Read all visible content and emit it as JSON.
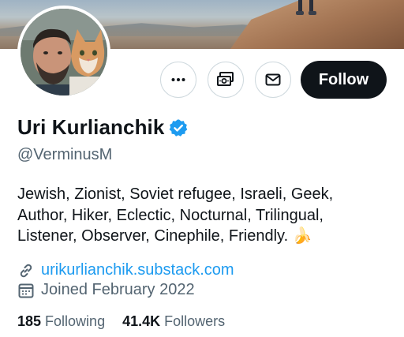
{
  "profile": {
    "display_name": "Uri Kurlianchik",
    "handle": "@VerminusM",
    "bio_lines": [
      "Jewish, Zionist, Soviet refugee, Israeli, Geek,",
      "Author, Hiker, Eclectic, Nocturnal, Trilingual,",
      "Listener, Observer, Cinephile, Friendly."
    ],
    "bio_emoji": "🍌",
    "website": "urikurlianchik.substack.com",
    "joined": "Joined February 2022",
    "verified": true
  },
  "actions": {
    "more_icon": "more-icon",
    "money_icon": "money-icon",
    "message_icon": "envelope-icon",
    "follow_label": "Follow"
  },
  "stats": {
    "following_count": "185",
    "following_label": "Following",
    "followers_count": "41.4K",
    "followers_label": "Followers"
  },
  "colors": {
    "link": "#1d9bf0",
    "verified": "#1d9bf0",
    "secondary_text": "#536471",
    "primary_text": "#0f1419",
    "follow_bg": "#0f1419"
  }
}
